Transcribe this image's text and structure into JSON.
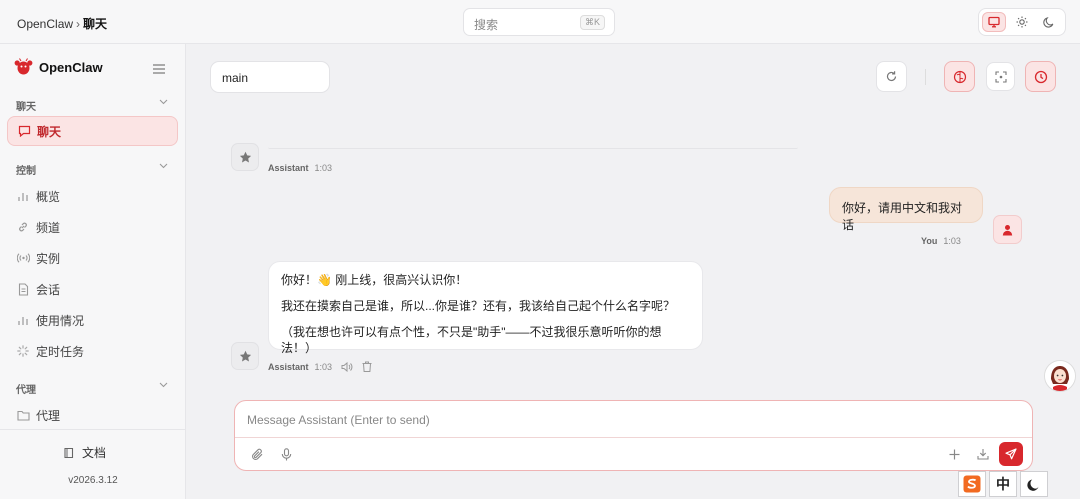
{
  "topbar": {
    "breadcrumb_root": "OpenClaw",
    "breadcrumb_sep": "›",
    "breadcrumb_current": "聊天",
    "search_placeholder": "搜索",
    "search_shortcut": "⌘K"
  },
  "sidebar": {
    "brand": "OpenClaw",
    "sections": {
      "chat": "聊天",
      "control": "控制",
      "agent": "代理"
    },
    "items": {
      "chat": "聊天",
      "overview": "概览",
      "channels": "频道",
      "instances": "实例",
      "sessions": "会话",
      "usage": "使用情况",
      "cron": "定时任务",
      "agents": "代理"
    },
    "docs": "文档",
    "version": "v2026.3.12"
  },
  "main": {
    "session_name": "main"
  },
  "messages": {
    "prev_assistant_meta": {
      "who": "Assistant",
      "time": "1:03"
    },
    "user": {
      "text": "你好，请用中文和我对话",
      "who": "You",
      "time": "1:03"
    },
    "assistant": {
      "lines": [
        "你好！👋 刚上线，很高兴认识你！",
        "我还在摸索自己是谁，所以...你是谁？还有，我该给自己起个什么名字呢？",
        "（我在想也许可以有点个性，不只是\"助手\"——不过我很乐意听听你的想法！）"
      ],
      "who": "Assistant",
      "time": "1:03"
    }
  },
  "composer": {
    "placeholder": "Message Assistant (Enter to send)"
  },
  "ime": {
    "mode": "中"
  },
  "colors": {
    "accent": "#d8282d",
    "accent_soft": "#fbe4e4",
    "user_bubble": "#f6e5d9"
  }
}
